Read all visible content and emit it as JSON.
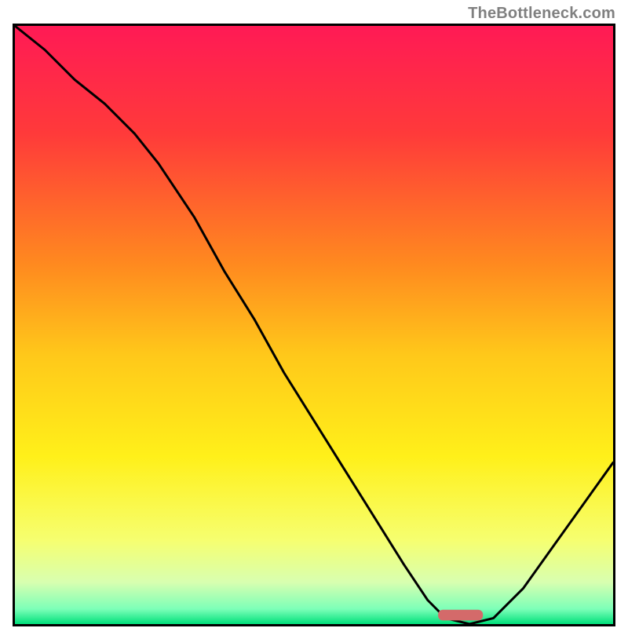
{
  "watermark": "TheBottleneck.com",
  "chart_data": {
    "type": "line",
    "title": "",
    "xlabel": "",
    "ylabel": "",
    "xlim": [
      0,
      100
    ],
    "ylim": [
      0,
      100
    ],
    "x": [
      0,
      5,
      10,
      15,
      20,
      24,
      30,
      35,
      40,
      45,
      50,
      55,
      60,
      65,
      69,
      72,
      76,
      80,
      85,
      90,
      95,
      100
    ],
    "values": [
      100,
      96,
      91,
      87,
      82,
      77,
      68,
      59,
      51,
      42,
      34,
      26,
      18,
      10,
      4,
      1,
      0,
      1,
      6,
      13,
      20,
      27
    ],
    "gradient_stops": [
      {
        "offset": 0.0,
        "color": "#ff1a55"
      },
      {
        "offset": 0.18,
        "color": "#ff3a3a"
      },
      {
        "offset": 0.4,
        "color": "#ff8a1f"
      },
      {
        "offset": 0.55,
        "color": "#ffc81a"
      },
      {
        "offset": 0.72,
        "color": "#fff01a"
      },
      {
        "offset": 0.86,
        "color": "#f6ff70"
      },
      {
        "offset": 0.93,
        "color": "#d8ffb0"
      },
      {
        "offset": 0.975,
        "color": "#7cffb8"
      },
      {
        "offset": 1.0,
        "color": "#00e07a"
      }
    ],
    "marker": {
      "x_center_frac": 0.745,
      "y_frac": 0.985,
      "w_frac": 0.075,
      "h_frac": 0.018,
      "rx": 6,
      "fill": "#d46a6a"
    },
    "annotations": []
  }
}
